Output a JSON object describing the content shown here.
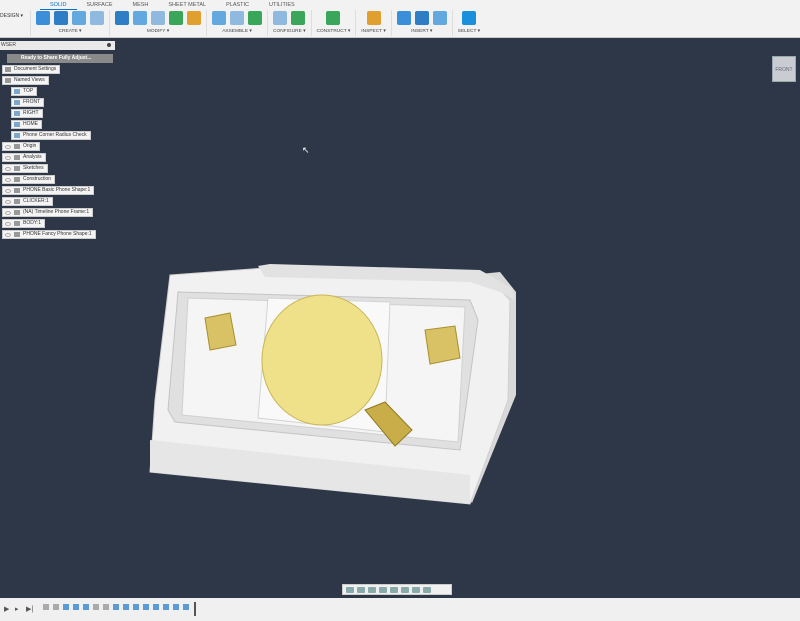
{
  "toolbar": {
    "workspace": "DESIGN ▾",
    "tabs": [
      "SOLID",
      "SURFACE",
      "MESH",
      "SHEET METAL",
      "PLASTIC",
      "UTILITIES"
    ],
    "active_tab": "SOLID",
    "groups": [
      {
        "label": "CREATE ▾",
        "icons": 4
      },
      {
        "label": "MODIFY ▾",
        "icons": 5
      },
      {
        "label": "ASSEMBLE ▾",
        "icons": 3
      },
      {
        "label": "CONFIGURE ▾",
        "icons": 2
      },
      {
        "label": "CONSTRUCT ▾",
        "icons": 1
      },
      {
        "label": "INSPECT ▾",
        "icons": 1
      },
      {
        "label": "INSERT ▾",
        "icons": 3
      },
      {
        "label": "SELECT ▾",
        "icons": 1
      }
    ]
  },
  "browser": {
    "title": "WSER",
    "root": "Ready to Share Fully Adjust...",
    "items": [
      {
        "label": "Document Settings",
        "type": "settings",
        "indent": 1
      },
      {
        "label": "Named Views",
        "type": "folder",
        "indent": 1
      },
      {
        "label": "TOP",
        "type": "view",
        "indent": 2
      },
      {
        "label": "FRONT",
        "type": "view",
        "indent": 2
      },
      {
        "label": "RIGHT",
        "type": "view",
        "indent": 2
      },
      {
        "label": "HOME",
        "type": "view",
        "indent": 2
      },
      {
        "label": "Phone Corner Radius Check",
        "type": "view",
        "indent": 2
      },
      {
        "label": "Origin",
        "type": "folder",
        "indent": 0
      },
      {
        "label": "Analysis",
        "type": "folder",
        "indent": 0
      },
      {
        "label": "Sketches",
        "type": "folder",
        "indent": 0
      },
      {
        "label": "Construction",
        "type": "folder",
        "indent": 0
      },
      {
        "label": "PHONE Basic Phone Shape:1",
        "type": "component",
        "indent": 0
      },
      {
        "label": "CLICKER:1",
        "type": "component",
        "indent": 0
      },
      {
        "label": "(NA) Timeline Phone Frame:1",
        "type": "component",
        "indent": 0
      },
      {
        "label": "BODY:1",
        "type": "component",
        "indent": 0
      },
      {
        "label": "PHONE Fancy Phone Shape:1",
        "type": "component",
        "indent": 0
      }
    ]
  },
  "viewcube": {
    "face": "FRONT"
  },
  "colors": {
    "viewport": "#2e3747",
    "accent": "#0b6fc4",
    "body": "#ececec",
    "gold": "#e8d67a"
  }
}
